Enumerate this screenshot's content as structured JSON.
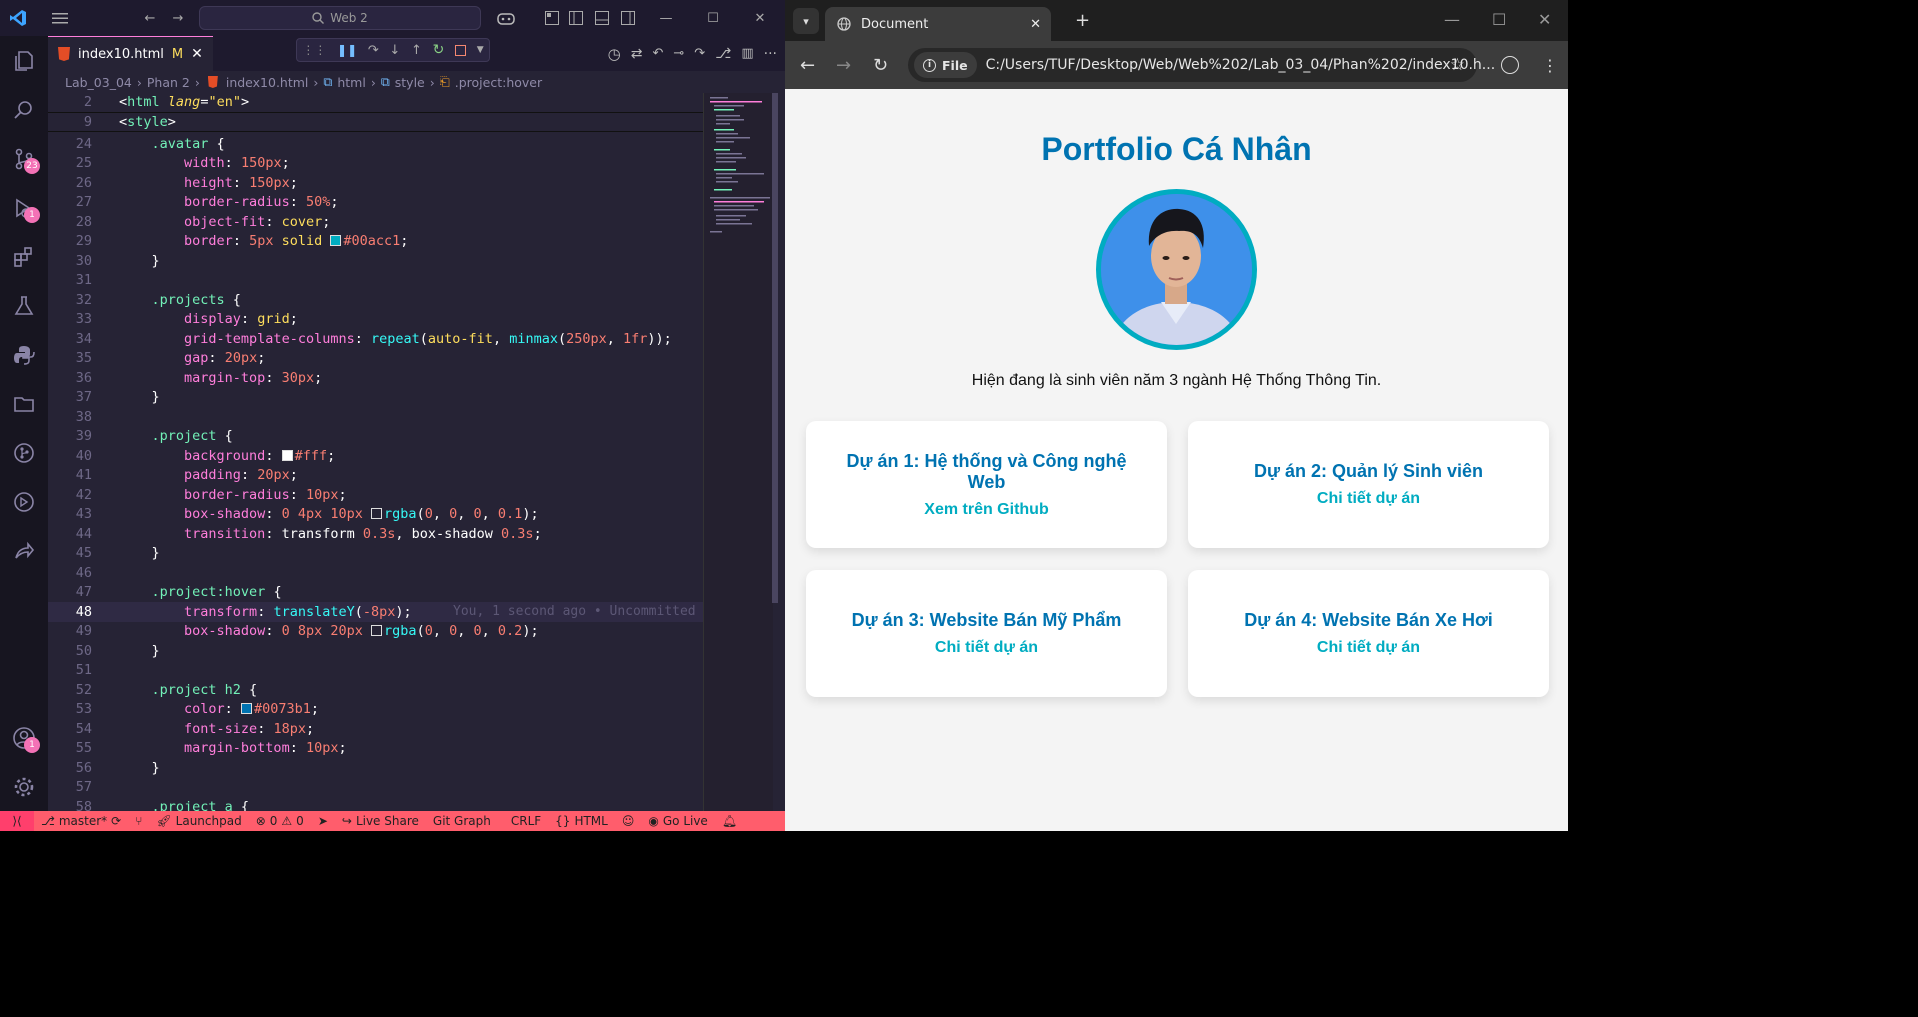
{
  "vscode": {
    "command_center": "Web 2",
    "tab": {
      "file": "index10.html",
      "modified": "M"
    },
    "breadcrumbs": [
      "Lab_03_04",
      "Phan 2",
      "index10.html",
      "html",
      "style",
      ".project:hover"
    ],
    "scm_badge": "23",
    "debug_badge": "1",
    "account_badge": "1",
    "blame": "You, 1 second ago • Uncommitted",
    "status": {
      "branch": "master*",
      "launchpad": "Launchpad",
      "problems": "0",
      "warnings": "0",
      "live_share": "Live Share",
      "git_graph": "Git Graph",
      "eol": "CRLF",
      "language": "HTML",
      "go_live": "Go Live"
    }
  },
  "code_lines": [
    {
      "n": "2",
      "segs": [
        [
          "c-wh",
          "<"
        ],
        [
          "c-tag",
          "html"
        ],
        [
          "c-wh",
          " "
        ],
        [
          "c-attr",
          "lang"
        ],
        [
          "c-wh",
          "="
        ],
        [
          "c-val",
          "\"en\""
        ],
        [
          "c-wh",
          ">"
        ]
      ]
    },
    {
      "n": "9",
      "segs": [
        [
          "c-wh",
          "<"
        ],
        [
          "c-tag",
          "style"
        ],
        [
          "c-wh",
          ">"
        ]
      ]
    },
    {
      "n": "24",
      "segs": [
        [
          "c-wh",
          "    "
        ],
        [
          "c-sel",
          ".avatar"
        ],
        [
          "c-wh",
          " {"
        ]
      ]
    },
    {
      "n": "25",
      "segs": [
        [
          "c-wh",
          "        "
        ],
        [
          "c-prop",
          "width"
        ],
        [
          "c-wh",
          ": "
        ],
        [
          "c-num",
          "150px"
        ],
        [
          "c-wh",
          ";"
        ]
      ]
    },
    {
      "n": "26",
      "segs": [
        [
          "c-wh",
          "        "
        ],
        [
          "c-prop",
          "height"
        ],
        [
          "c-wh",
          ": "
        ],
        [
          "c-num",
          "150px"
        ],
        [
          "c-wh",
          ";"
        ]
      ]
    },
    {
      "n": "27",
      "segs": [
        [
          "c-wh",
          "        "
        ],
        [
          "c-prop",
          "border-radius"
        ],
        [
          "c-wh",
          ": "
        ],
        [
          "c-num",
          "50%"
        ],
        [
          "c-wh",
          ";"
        ]
      ]
    },
    {
      "n": "28",
      "segs": [
        [
          "c-wh",
          "        "
        ],
        [
          "c-prop",
          "object-fit"
        ],
        [
          "c-wh",
          ": "
        ],
        [
          "c-val",
          "cover"
        ],
        [
          "c-wh",
          ";"
        ]
      ]
    },
    {
      "n": "29",
      "segs": [
        [
          "c-wh",
          "        "
        ],
        [
          "c-prop",
          "border"
        ],
        [
          "c-wh",
          ": "
        ],
        [
          "c-num",
          "5px"
        ],
        [
          "c-wh",
          " "
        ],
        [
          "c-val",
          "solid"
        ],
        [
          "c-wh",
          " "
        ],
        [
          "sw",
          "#00acc1"
        ],
        [
          "c-num",
          "#00acc1"
        ],
        [
          "c-wh",
          ";"
        ]
      ]
    },
    {
      "n": "30",
      "segs": [
        [
          "c-wh",
          "    }"
        ]
      ]
    },
    {
      "n": "31",
      "segs": []
    },
    {
      "n": "32",
      "segs": [
        [
          "c-wh",
          "    "
        ],
        [
          "c-sel",
          ".projects"
        ],
        [
          "c-wh",
          " {"
        ]
      ]
    },
    {
      "n": "33",
      "segs": [
        [
          "c-wh",
          "        "
        ],
        [
          "c-prop",
          "display"
        ],
        [
          "c-wh",
          ": "
        ],
        [
          "c-val",
          "grid"
        ],
        [
          "c-wh",
          ";"
        ]
      ]
    },
    {
      "n": "34",
      "segs": [
        [
          "c-wh",
          "        "
        ],
        [
          "c-prop",
          "grid-template-columns"
        ],
        [
          "c-wh",
          ": "
        ],
        [
          "c-fn",
          "repeat"
        ],
        [
          "c-wh",
          "("
        ],
        [
          "c-val",
          "auto-fit"
        ],
        [
          "c-wh",
          ", "
        ],
        [
          "c-fn",
          "minmax"
        ],
        [
          "c-wh",
          "("
        ],
        [
          "c-num",
          "250px"
        ],
        [
          "c-wh",
          ", "
        ],
        [
          "c-num",
          "1fr"
        ],
        [
          "c-wh",
          "));"
        ]
      ]
    },
    {
      "n": "35",
      "segs": [
        [
          "c-wh",
          "        "
        ],
        [
          "c-prop",
          "gap"
        ],
        [
          "c-wh",
          ": "
        ],
        [
          "c-num",
          "20px"
        ],
        [
          "c-wh",
          ";"
        ]
      ]
    },
    {
      "n": "36",
      "segs": [
        [
          "c-wh",
          "        "
        ],
        [
          "c-prop",
          "margin-top"
        ],
        [
          "c-wh",
          ": "
        ],
        [
          "c-num",
          "30px"
        ],
        [
          "c-wh",
          ";"
        ]
      ]
    },
    {
      "n": "37",
      "segs": [
        [
          "c-wh",
          "    }"
        ]
      ]
    },
    {
      "n": "38",
      "segs": []
    },
    {
      "n": "39",
      "segs": [
        [
          "c-wh",
          "    "
        ],
        [
          "c-sel",
          ".project"
        ],
        [
          "c-wh",
          " {"
        ]
      ]
    },
    {
      "n": "40",
      "segs": [
        [
          "c-wh",
          "        "
        ],
        [
          "c-prop",
          "background"
        ],
        [
          "c-wh",
          ": "
        ],
        [
          "sw",
          "#ffffff"
        ],
        [
          "c-num",
          "#fff"
        ],
        [
          "c-wh",
          ";"
        ]
      ]
    },
    {
      "n": "41",
      "segs": [
        [
          "c-wh",
          "        "
        ],
        [
          "c-prop",
          "padding"
        ],
        [
          "c-wh",
          ": "
        ],
        [
          "c-num",
          "20px"
        ],
        [
          "c-wh",
          ";"
        ]
      ]
    },
    {
      "n": "42",
      "segs": [
        [
          "c-wh",
          "        "
        ],
        [
          "c-prop",
          "border-radius"
        ],
        [
          "c-wh",
          ": "
        ],
        [
          "c-num",
          "10px"
        ],
        [
          "c-wh",
          ";"
        ]
      ]
    },
    {
      "n": "43",
      "segs": [
        [
          "c-wh",
          "        "
        ],
        [
          "c-prop",
          "box-shadow"
        ],
        [
          "c-wh",
          ": "
        ],
        [
          "c-num",
          "0"
        ],
        [
          "c-wh",
          " "
        ],
        [
          "c-num",
          "4px"
        ],
        [
          "c-wh",
          " "
        ],
        [
          "c-num",
          "10px"
        ],
        [
          "c-wh",
          " "
        ],
        [
          "sw",
          "transparent"
        ],
        [
          "c-fn",
          "rgba"
        ],
        [
          "c-wh",
          "("
        ],
        [
          "c-num",
          "0"
        ],
        [
          "c-wh",
          ", "
        ],
        [
          "c-num",
          "0"
        ],
        [
          "c-wh",
          ", "
        ],
        [
          "c-num",
          "0"
        ],
        [
          "c-wh",
          ", "
        ],
        [
          "c-num",
          "0.1"
        ],
        [
          "c-wh",
          ");"
        ]
      ]
    },
    {
      "n": "44",
      "segs": [
        [
          "c-wh",
          "        "
        ],
        [
          "c-prop",
          "transition"
        ],
        [
          "c-wh",
          ": "
        ],
        [
          "c-wh",
          "transform "
        ],
        [
          "c-num",
          "0.3s"
        ],
        [
          "c-wh",
          ", box-shadow "
        ],
        [
          "c-num",
          "0.3s"
        ],
        [
          "c-wh",
          ";"
        ]
      ]
    },
    {
      "n": "45",
      "segs": [
        [
          "c-wh",
          "    }"
        ]
      ]
    },
    {
      "n": "46",
      "segs": []
    },
    {
      "n": "47",
      "segs": [
        [
          "c-wh",
          "    "
        ],
        [
          "c-sel",
          ".project:hover"
        ],
        [
          "c-wh",
          " {"
        ]
      ]
    },
    {
      "n": "48",
      "segs": [
        [
          "c-wh",
          "        "
        ],
        [
          "c-prop",
          "transform"
        ],
        [
          "c-wh",
          ": "
        ],
        [
          "c-fn",
          "translateY"
        ],
        [
          "c-wh",
          "("
        ],
        [
          "c-num",
          "-8px"
        ],
        [
          "c-wh",
          ");"
        ]
      ],
      "current": true
    },
    {
      "n": "49",
      "segs": [
        [
          "c-wh",
          "        "
        ],
        [
          "c-prop",
          "box-shadow"
        ],
        [
          "c-wh",
          ": "
        ],
        [
          "c-num",
          "0"
        ],
        [
          "c-wh",
          " "
        ],
        [
          "c-num",
          "8px"
        ],
        [
          "c-wh",
          " "
        ],
        [
          "c-num",
          "20px"
        ],
        [
          "c-wh",
          " "
        ],
        [
          "sw",
          "transparent"
        ],
        [
          "c-fn",
          "rgba"
        ],
        [
          "c-wh",
          "("
        ],
        [
          "c-num",
          "0"
        ],
        [
          "c-wh",
          ", "
        ],
        [
          "c-num",
          "0"
        ],
        [
          "c-wh",
          ", "
        ],
        [
          "c-num",
          "0"
        ],
        [
          "c-wh",
          ", "
        ],
        [
          "c-num",
          "0.2"
        ],
        [
          "c-wh",
          ");"
        ]
      ]
    },
    {
      "n": "50",
      "segs": [
        [
          "c-wh",
          "    }"
        ]
      ]
    },
    {
      "n": "51",
      "segs": []
    },
    {
      "n": "52",
      "segs": [
        [
          "c-wh",
          "    "
        ],
        [
          "c-sel",
          ".project h2"
        ],
        [
          "c-wh",
          " {"
        ]
      ]
    },
    {
      "n": "53",
      "segs": [
        [
          "c-wh",
          "        "
        ],
        [
          "c-prop",
          "color"
        ],
        [
          "c-wh",
          ": "
        ],
        [
          "sw",
          "#0073b1"
        ],
        [
          "c-num",
          "#0073b1"
        ],
        [
          "c-wh",
          ";"
        ]
      ]
    },
    {
      "n": "54",
      "segs": [
        [
          "c-wh",
          "        "
        ],
        [
          "c-prop",
          "font-size"
        ],
        [
          "c-wh",
          ": "
        ],
        [
          "c-num",
          "18px"
        ],
        [
          "c-wh",
          ";"
        ]
      ]
    },
    {
      "n": "55",
      "segs": [
        [
          "c-wh",
          "        "
        ],
        [
          "c-prop",
          "margin-bottom"
        ],
        [
          "c-wh",
          ": "
        ],
        [
          "c-num",
          "10px"
        ],
        [
          "c-wh",
          ";"
        ]
      ]
    },
    {
      "n": "56",
      "segs": [
        [
          "c-wh",
          "    }"
        ]
      ]
    },
    {
      "n": "57",
      "segs": []
    },
    {
      "n": "58",
      "segs": [
        [
          "c-wh",
          "    "
        ],
        [
          "c-sel",
          ".project a"
        ],
        [
          "c-wh",
          " {"
        ]
      ]
    }
  ],
  "browser": {
    "tab_title": "Document",
    "site_chip": "File",
    "url": "C:/Users/TUF/Desktop/Web/Web%202/Lab_03_04/Phan%202/index10.h..."
  },
  "page": {
    "title": "Portfolio Cá Nhân",
    "bio": "Hiện đang là sinh viên năm 3 ngành Hệ Thống Thông Tin.",
    "projects": [
      {
        "title": "Dự án 1: Hệ thống và Công nghệ Web",
        "link": "Xem trên Github"
      },
      {
        "title": "Dự án 2: Quản lý Sinh viên",
        "link": "Chi tiết dự án"
      },
      {
        "title": "Dự án 3: Website Bán Mỹ Phẩm",
        "link": "Chi tiết dự án"
      },
      {
        "title": "Dự án 4: Website Bán Xe Hơi",
        "link": "Chi tiết dự án"
      }
    ]
  },
  "colors": {
    "heading": "#0073b1",
    "accent": "#00acc1",
    "statusbar": "#ff5d6c"
  }
}
